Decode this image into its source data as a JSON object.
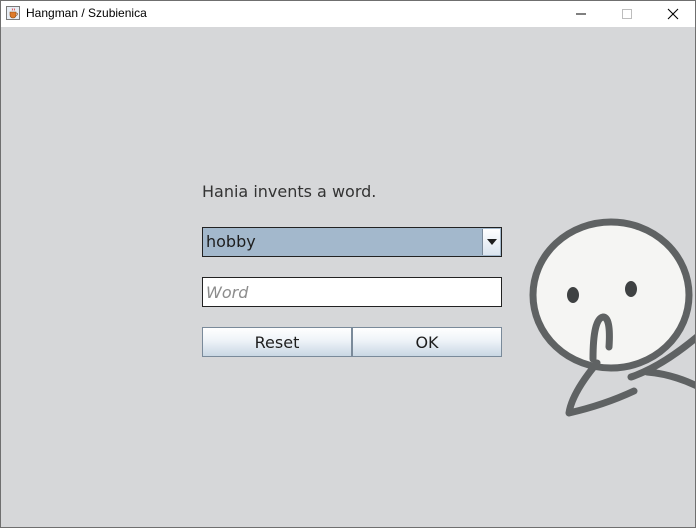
{
  "window": {
    "title": "Hangman / Szubienica",
    "icon": "java-cup-icon",
    "controls": {
      "minimize": "minimize-icon",
      "maximize": "maximize-icon",
      "close": "close-icon"
    }
  },
  "main": {
    "prompt": "Hania invents a word.",
    "category_select": {
      "selected": "hobby",
      "arrow_icon": "chevron-down-icon"
    },
    "word_input": {
      "value": "",
      "placeholder": "Word"
    },
    "buttons": {
      "reset": "Reset",
      "ok": "OK"
    },
    "decoration": "stickman-face-drawing"
  },
  "colors": {
    "background": "#d6d7d9",
    "combo_selected": "#a3b8cc",
    "text": "#333333"
  }
}
